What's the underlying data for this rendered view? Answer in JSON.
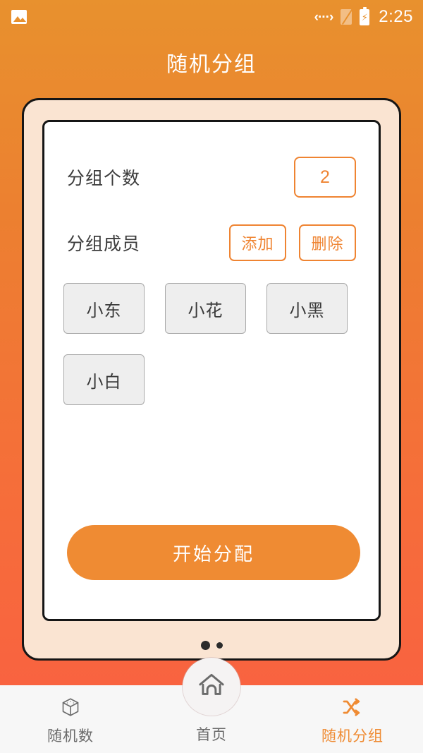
{
  "status_bar": {
    "photo_icon": "photo-icon",
    "usb_icon": "usb-debug-icon",
    "usb_glyph": "‹···›",
    "sim_icon": "sim-off-icon",
    "battery_icon": "battery-charging-icon",
    "battery_glyph": "⚡",
    "time": "2:25"
  },
  "header": {
    "title": "随机分组"
  },
  "form": {
    "groups_label": "分组个数",
    "groups_count": "2",
    "members_label": "分组成员",
    "add_label": "添加",
    "delete_label": "删除",
    "members": [
      {
        "name": "小东"
      },
      {
        "name": "小花"
      },
      {
        "name": "小黑"
      },
      {
        "name": "小白"
      }
    ],
    "start_label": "开始分配"
  },
  "bottom_nav": {
    "items": [
      {
        "label": "随机数",
        "icon": "dice-icon",
        "active": false
      },
      {
        "label": "首页",
        "icon": "home-icon",
        "active": false
      },
      {
        "label": "随机分组",
        "icon": "shuffle-icon",
        "active": true
      }
    ]
  },
  "colors": {
    "accent": "#ef8b33",
    "bg_top": "#e8912e",
    "bg_bottom": "#fa5f42",
    "bezel": "#fae4d2",
    "chip_bg": "#eeeeee"
  }
}
